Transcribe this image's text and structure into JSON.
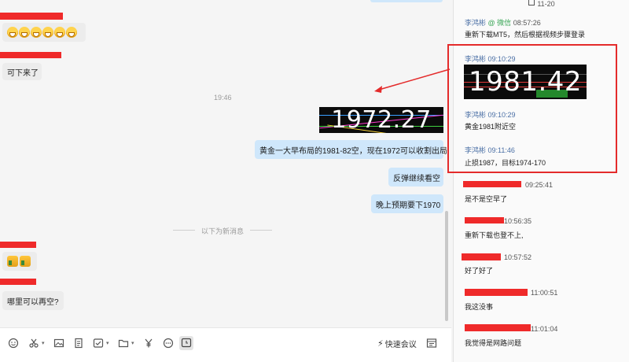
{
  "chat": {
    "emoji_count": 6,
    "msg_kexia": "可下来了",
    "timestamp": "19:46",
    "price_image_value": "1972.27",
    "msg_out_1": "黄金一大早布局的1981-82空，现在1972可以收割出局",
    "msg_out_2": "反弹继续看空",
    "msg_out_3": "晚上预期要下1970",
    "new_messages_divider": "以下为新消息",
    "thumbs_count": 2,
    "msg_in_last": "哪里可以再空?"
  },
  "toolbar": {
    "emoji_icon": "smile-icon",
    "scissors_icon": "scissors-icon",
    "image_icon": "image-icon",
    "file_icon": "file-icon",
    "check_icon": "checkbox-icon",
    "folder_icon": "folder-icon",
    "money_icon": "yen-icon",
    "more_icon": "more-icon",
    "screen_icon": "screen-icon",
    "quick_meeting_label": "快速会议",
    "history_icon": "history-icon"
  },
  "side": {
    "date_header": "11-20",
    "items": [
      {
        "name": "李鸿彬",
        "tag": "@ 微信",
        "time": "08:57:26",
        "msg": "重新下载MT5，然后根据视频步骤登录"
      },
      {
        "name": "李鸿彬",
        "time": "09:10:29",
        "image_value": "1981.42"
      },
      {
        "name": "李鸿彬",
        "time": "09:10:29",
        "msg": "黄金1981附近空"
      },
      {
        "name": "李鸿彬",
        "time": "09:11:46",
        "msg": "止损1987，目标1974-170"
      },
      {
        "time": "09:25:41",
        "msg": "是不是空早了"
      },
      {
        "time": "10:56:35",
        "msg": "重新下载也登不上,"
      },
      {
        "time": "10:57:52",
        "msg": "好了好了"
      },
      {
        "time": "11:00:51",
        "msg": "我这没事"
      },
      {
        "time": "11:01:04",
        "msg": "我觉得是网路问题"
      }
    ]
  },
  "colors": {
    "redact": "#ef2a2a",
    "highlight_border": "#e42b2b",
    "out_bubble": "#cfe7fb",
    "in_bubble": "#ececec",
    "name_blue": "#4a6fa5",
    "wechat_green": "#3aa657"
  }
}
